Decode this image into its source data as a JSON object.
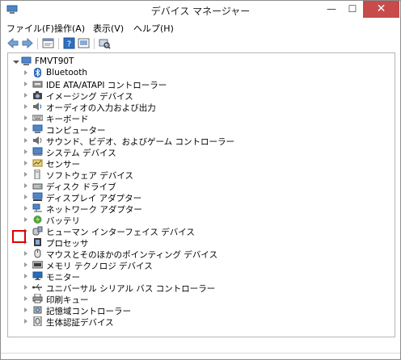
{
  "window": {
    "title": "デバイス マネージャー",
    "minimize": "—",
    "maximize": "☐",
    "close": "✕"
  },
  "menu": [
    "ファイル(F)",
    "操作(A)",
    "表示(V)",
    "ヘルプ(H)"
  ],
  "tree": {
    "root": "FMVT90T",
    "items": [
      {
        "label": "Bluetooth",
        "icon": "bluetooth-icon"
      },
      {
        "label": "IDE ATA/ATAPI コントローラー",
        "icon": "ide-controller-icon"
      },
      {
        "label": "イメージング デバイス",
        "icon": "camera-icon"
      },
      {
        "label": "オーディオの入力および出力",
        "icon": "speaker-icon"
      },
      {
        "label": "キーボード",
        "icon": "keyboard-icon"
      },
      {
        "label": "コンピューター",
        "icon": "computer-icon"
      },
      {
        "label": "サウンド、ビデオ、およびゲーム コントローラー",
        "icon": "sound-icon"
      },
      {
        "label": "システム デバイス",
        "icon": "system-devices-icon"
      },
      {
        "label": "センサー",
        "icon": "sensor-icon"
      },
      {
        "label": "ソフトウェア デバイス",
        "icon": "software-device-icon"
      },
      {
        "label": "ディスク ドライブ",
        "icon": "disk-drive-icon"
      },
      {
        "label": "ディスプレイ アダプター",
        "icon": "display-adapter-icon"
      },
      {
        "label": "ネットワーク アダプター",
        "icon": "network-adapter-icon"
      },
      {
        "label": "バッテリ",
        "icon": "battery-icon"
      },
      {
        "label": "ヒューマン インターフェイス デバイス",
        "icon": "hid-icon"
      },
      {
        "label": "プロセッサ",
        "icon": "processor-icon"
      },
      {
        "label": "マウスとそのほかのポインティング デバイス",
        "icon": "mouse-icon"
      },
      {
        "label": "メモリ テクノロジ デバイス",
        "icon": "memory-icon"
      },
      {
        "label": "モニター",
        "icon": "monitor-icon"
      },
      {
        "label": "ユニバーサル シリアル バス コントローラー",
        "icon": "usb-icon"
      },
      {
        "label": "印刷キュー",
        "icon": "printer-icon"
      },
      {
        "label": "記憶域コントローラー",
        "icon": "storage-controller-icon"
      },
      {
        "label": "生体認証デバイス",
        "icon": "biometric-icon"
      }
    ]
  },
  "colors": {
    "close_button": "#c74b4b",
    "highlight_box": "#e00000",
    "icon_blue": "#2b6cb8"
  }
}
